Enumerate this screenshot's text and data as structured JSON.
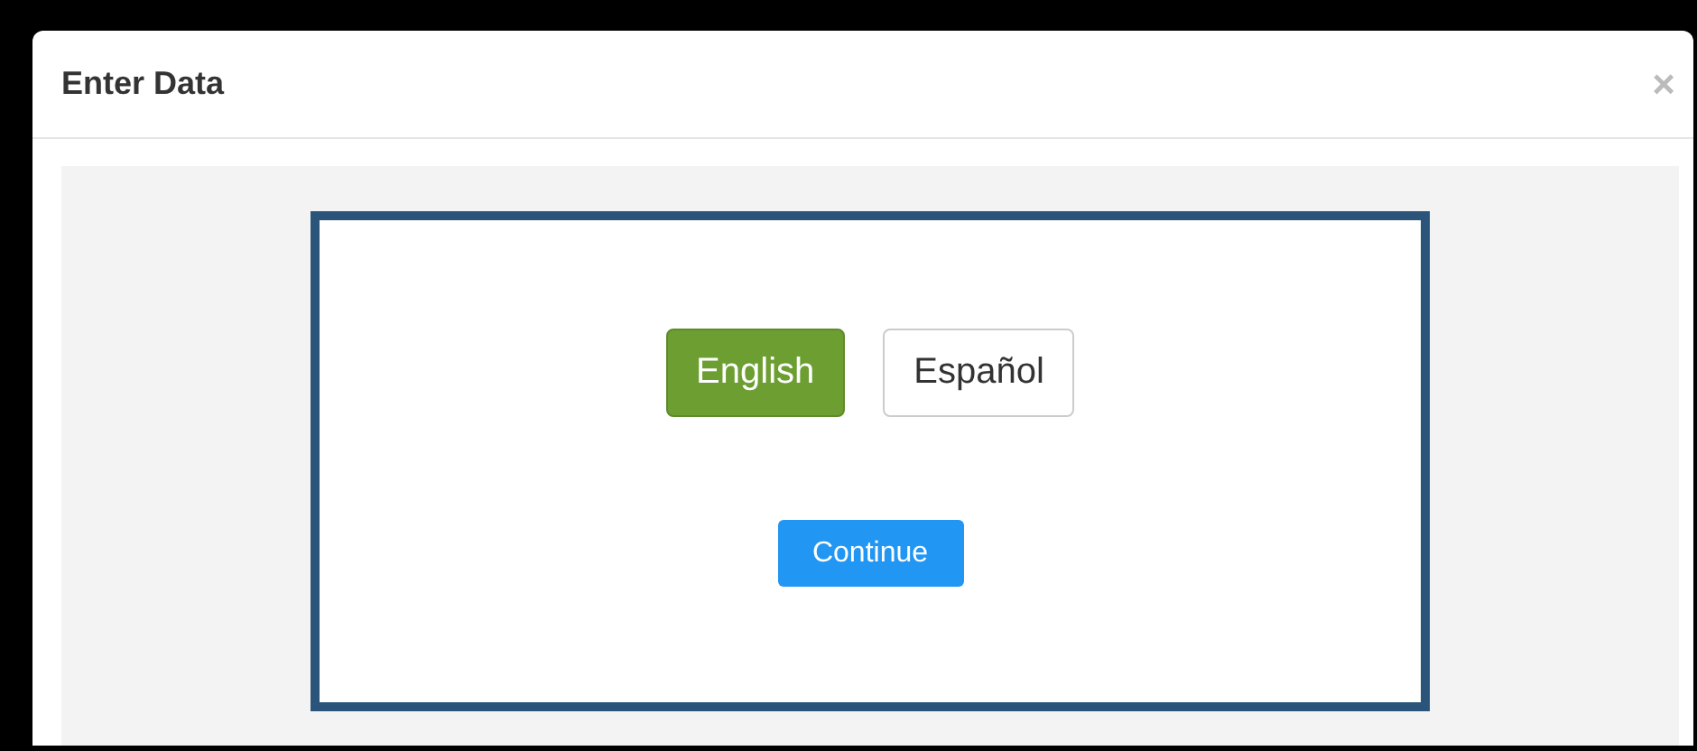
{
  "dialog": {
    "title": "Enter Data",
    "close": "×"
  },
  "languages": [
    {
      "label": "English",
      "selected": true
    },
    {
      "label": "Español",
      "selected": false
    }
  ],
  "continue_button": "Continue"
}
